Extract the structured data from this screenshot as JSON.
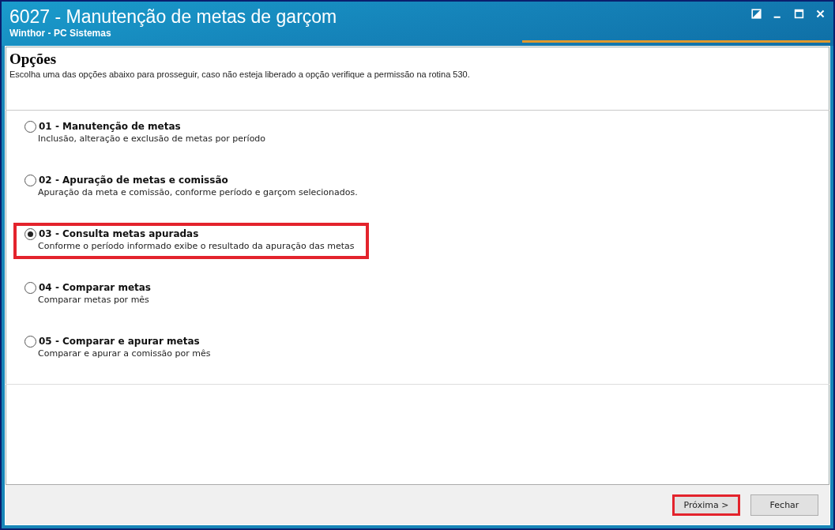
{
  "window": {
    "title": "6027 - Manutenção de metas de garçom",
    "subtitle": "Winthor - PC Sistemas"
  },
  "header": {
    "title": "Opções",
    "description": "Escolha uma das opções abaixo para prosseguir, caso não esteja liberado a opção verifique a permissão na rotina 530."
  },
  "options": [
    {
      "title": "01 - Manutenção de metas",
      "description": "Inclusão, alteração e exclusão de metas por período",
      "selected": false,
      "highlighted": false
    },
    {
      "title": "02 - Apuração de metas e comissão",
      "description": "Apuração da meta e comissão, conforme período e garçom selecionados.",
      "selected": false,
      "highlighted": false
    },
    {
      "title": "03 - Consulta metas apuradas",
      "description": "Conforme o período informado exibe o resultado da apuração das metas",
      "selected": true,
      "highlighted": true
    },
    {
      "title": "04 - Comparar metas",
      "description": "Comparar metas por mês",
      "selected": false,
      "highlighted": false
    },
    {
      "title": "05 - Comparar e apurar metas",
      "description": "Comparar e apurar a comissão por mês",
      "selected": false,
      "highlighted": false
    }
  ],
  "buttons": [
    {
      "label": "Próxima >",
      "highlighted": true
    },
    {
      "label": "Fechar",
      "highlighted": false
    }
  ]
}
